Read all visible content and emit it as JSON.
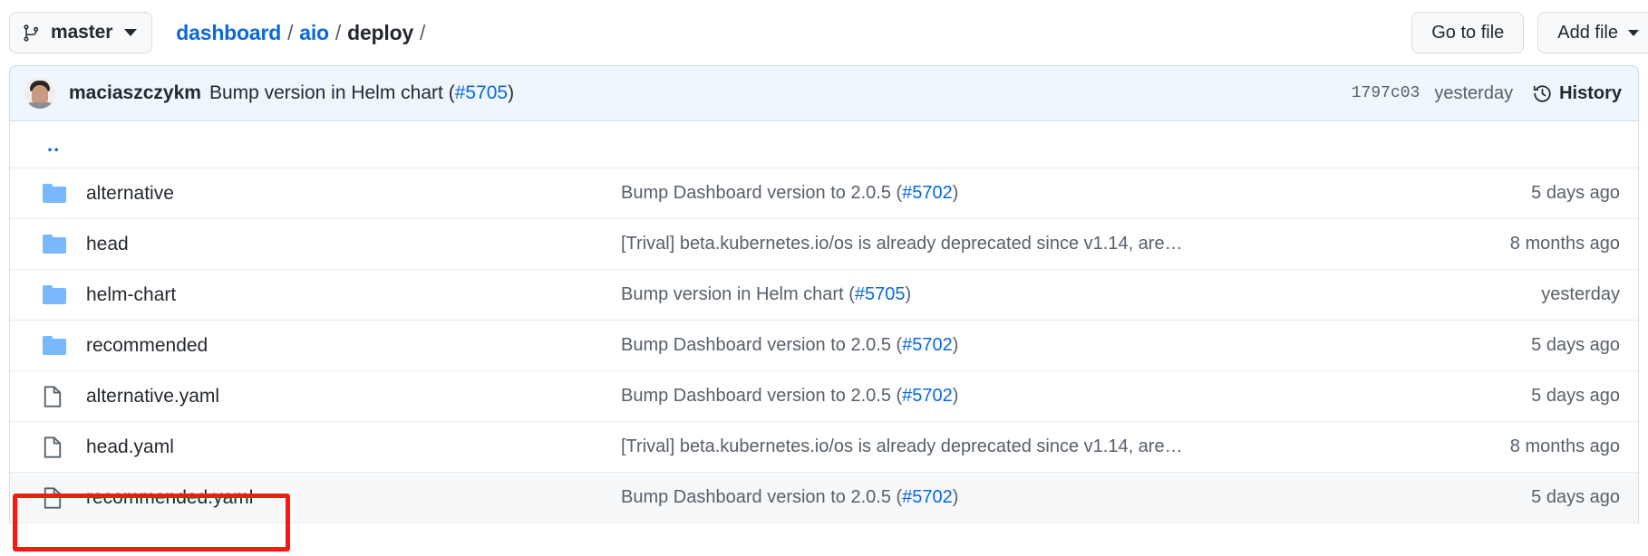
{
  "topbar": {
    "branch": {
      "icon": "git-branch-icon",
      "label": "master",
      "caret": "chevron-down-icon"
    },
    "breadcrumb": {
      "parts": [
        {
          "label": "dashboard",
          "link": true
        },
        {
          "label": "aio",
          "link": true
        },
        {
          "label": "deploy",
          "link": false
        }
      ],
      "separator": "/",
      "trailing_separator": "/"
    },
    "actions": [
      {
        "label": "Go to file",
        "caret": false
      },
      {
        "label": "Add file",
        "caret": true
      }
    ]
  },
  "commit_bar": {
    "avatar_name": "maciaszczykm-avatar",
    "author": "maciaszczykm",
    "message_prefix": "Bump version in Helm chart (",
    "message_ref": "#5705",
    "message_suffix": ")",
    "hash": "1797c03",
    "time": "yesterday",
    "history_icon": "history-clock-icon",
    "history_label": "History"
  },
  "file_table": {
    "parent_label": "..",
    "rows": [
      {
        "icon": "folder-icon",
        "name": "alternative",
        "msg_prefix": "Bump Dashboard version to 2.0.5 (",
        "msg_ref": "#5702",
        "msg_suffix": ")",
        "time": "5 days ago",
        "hover": false,
        "highlighted": false
      },
      {
        "icon": "folder-icon",
        "name": "head",
        "msg_prefix": "[Trival] beta.kubernetes.io/os is already deprecated since v1.14, are…",
        "msg_ref": "",
        "msg_suffix": "",
        "time": "8 months ago",
        "hover": false,
        "highlighted": false
      },
      {
        "icon": "folder-icon",
        "name": "helm-chart",
        "msg_prefix": "Bump version in Helm chart (",
        "msg_ref": "#5705",
        "msg_suffix": ")",
        "time": "yesterday",
        "hover": false,
        "highlighted": false
      },
      {
        "icon": "folder-icon",
        "name": "recommended",
        "msg_prefix": "Bump Dashboard version to 2.0.5 (",
        "msg_ref": "#5702",
        "msg_suffix": ")",
        "time": "5 days ago",
        "hover": false,
        "highlighted": false
      },
      {
        "icon": "file-icon",
        "name": "alternative.yaml",
        "msg_prefix": "Bump Dashboard version to 2.0.5 (",
        "msg_ref": "#5702",
        "msg_suffix": ")",
        "time": "5 days ago",
        "hover": false,
        "highlighted": false
      },
      {
        "icon": "file-icon",
        "name": "head.yaml",
        "msg_prefix": "[Trival] beta.kubernetes.io/os is already deprecated since v1.14, are…",
        "msg_ref": "",
        "msg_suffix": "",
        "time": "8 months ago",
        "hover": false,
        "highlighted": false
      },
      {
        "icon": "file-icon",
        "name": "recommended.yaml",
        "msg_prefix": "Bump Dashboard version to 2.0.5 (",
        "msg_ref": "#5702",
        "msg_suffix": ")",
        "time": "5 days ago",
        "hover": true,
        "highlighted": true
      }
    ]
  },
  "colors": {
    "link": "#0969da",
    "text": "#24292f",
    "muted": "#57606a",
    "folder": "#79b8ff",
    "commit_bar_bg": "#eff6fd",
    "commit_bar_border": "#c9dcf0",
    "row_hover_bg": "#f6f8fa",
    "highlight_red": "#f51b0f",
    "border": "#d8dde2"
  }
}
